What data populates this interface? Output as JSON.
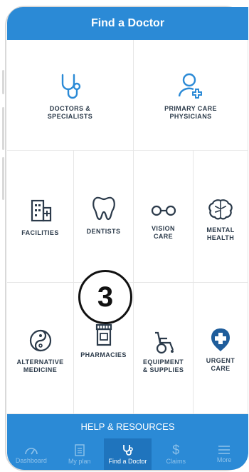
{
  "header": {
    "title": "Find a Doctor"
  },
  "tiles_row1": [
    {
      "label": "DOCTORS &\nSPECIALISTS",
      "icon": "stethoscope-icon"
    },
    {
      "label": "PRIMARY CARE\nPHYSICIANS",
      "icon": "person-plus-icon"
    }
  ],
  "tiles_row2": [
    {
      "label": "FACILITIES",
      "icon": "building-icon"
    },
    {
      "label": "DENTISTS",
      "icon": "tooth-icon"
    },
    {
      "label": "VISION\nCARE",
      "icon": "glasses-icon"
    },
    {
      "label": "MENTAL\nHEALTH",
      "icon": "brain-icon"
    }
  ],
  "tiles_row3": [
    {
      "label": "ALTERNATIVE\nMEDICINE",
      "icon": "yin-yang-icon"
    },
    {
      "label": "PHARMACIES",
      "icon": "pill-bottle-icon"
    },
    {
      "label": "EQUIPMENT\n& SUPPLIES",
      "icon": "wheelchair-icon"
    },
    {
      "label": "URGENT\nCARE",
      "icon": "urgent-care-icon"
    }
  ],
  "help": {
    "label": "HELP & RESOURCES"
  },
  "tabs": [
    {
      "label": "Dashboard",
      "icon": "gauge-icon"
    },
    {
      "label": "My plan",
      "icon": "document-icon"
    },
    {
      "label": "Find a Doctor",
      "icon": "stethoscope-icon",
      "active": true
    },
    {
      "label": "Claims",
      "icon": "dollar-icon"
    },
    {
      "label": "More",
      "icon": "menu-icon"
    }
  ],
  "step_badge": "3",
  "colors": {
    "primary": "#2b8ad6",
    "primary_dark": "#1f74bd",
    "text": "#2b3a4a"
  }
}
